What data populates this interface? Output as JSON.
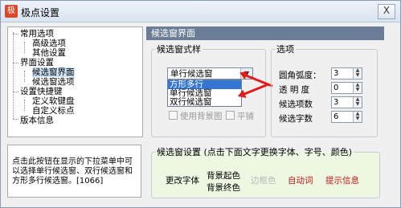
{
  "window": {
    "title": "极点设置",
    "close_label": "X",
    "app_icon": "logo-icon"
  },
  "tree": {
    "items": [
      {
        "label": "常用选项"
      },
      {
        "label": "高级选项"
      },
      {
        "label": "其他设置"
      },
      {
        "label": "界面设置"
      },
      {
        "label": "候选窗界面"
      },
      {
        "label": "候选窗选项"
      },
      {
        "label": "设置快捷键"
      },
      {
        "label": "定义软键盘"
      },
      {
        "label": "自定义标点"
      },
      {
        "label": "版本信息"
      }
    ]
  },
  "help_text": "点击此按钮在显示的下拉菜单中可以选择单行候选窗、双行候选窗和方形多行候选窗。[1066]",
  "panel": {
    "title": "候选窗界面"
  },
  "style_group": {
    "legend": "候选窗式样",
    "combo_value": "单行候选窗",
    "options": [
      "方形多行",
      "单行候选窗",
      "双行候选窗"
    ],
    "highlighted_option": "方形多行",
    "use_bg_label": "使用背景图",
    "tile_label": "平铺"
  },
  "options_group": {
    "legend": "选项",
    "corner_label": "圆角弧度：",
    "corner_value": "3",
    "opacity_label": "透 明 度",
    "opacity_value": "0",
    "count_label": "候选项数",
    "count_value": "3",
    "chars_label": "候选字数",
    "chars_value": "6"
  },
  "window_settings": {
    "legend": "候选窗设置 (点击下面文字更换字体、字号、颜色)",
    "font_label": "更改字体",
    "bg_start_label": "背景起色",
    "bg_end_label": "背景终色",
    "border_label": "边框色",
    "auto_word_label": "自动词",
    "hint_label": "提示信息",
    "colors": {
      "border": "#b9b9b9",
      "auto_word": "#c01818",
      "hint": "#c01818"
    }
  },
  "colors": {
    "panel_header": "#6b7d96",
    "highlight": "#3476d2",
    "annotation": "#e11c1c"
  }
}
